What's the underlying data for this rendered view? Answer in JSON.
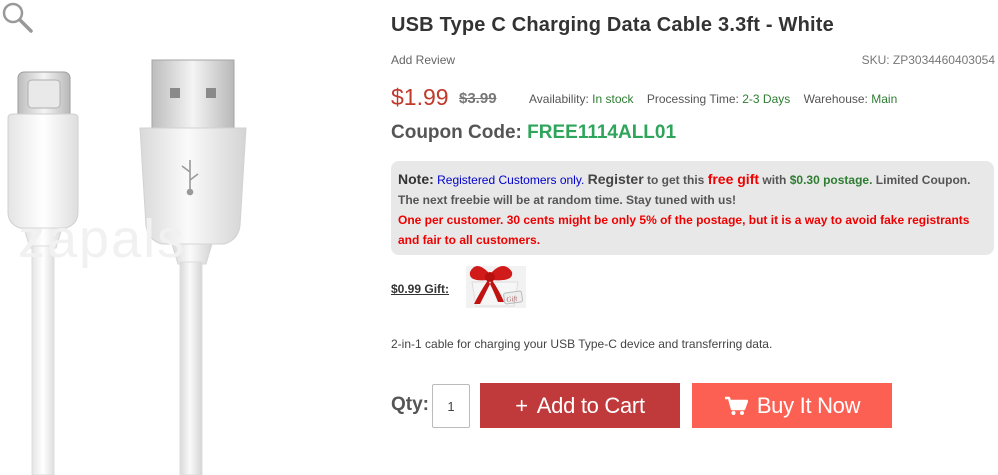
{
  "product": {
    "title": "USB Type C Charging Data Cable 3.3ft - White",
    "add_review": "Add Review",
    "sku": "SKU: ZP3034460403054",
    "price": "$1.99",
    "old_price": "$3.99"
  },
  "meta": {
    "availability_label": "Availability:",
    "availability_value": "In stock",
    "processing_label": "Processing Time:",
    "processing_value": "2-3 Days",
    "warehouse_label": "Warehouse:",
    "warehouse_value": "Main"
  },
  "coupon": {
    "label": "Coupon Code:",
    "code": "FREE1114ALL01"
  },
  "note": {
    "label": "Note:",
    "registered": "Registered Customers only.",
    "register": "Register",
    "get_this": "to get this",
    "free_gift": "free gift",
    "with": "with",
    "postage": "$0.30 postage.",
    "limited": "Limited Coupon. The next freebie will be at random time. Stay tuned with us!",
    "warning": "One per customer. 30 cents might be only 5% of the postage, but it is a way to avoid fake registrants and fair to all customers."
  },
  "gift": {
    "label": "$0.99 Gift:",
    "tag_text": "Gift"
  },
  "description": "2-in-1 cable for charging your USB Type-C device and transferring data.",
  "purchase": {
    "qty_label": "Qty:",
    "qty_value": "1",
    "add_to_cart": "Add to Cart",
    "buy_now": "Buy It Now"
  },
  "image": {
    "watermark": "zapals"
  },
  "icons": {
    "zoom": "magnifier-icon",
    "cart": "cart-icon",
    "plus": "plus-icon",
    "usb": "usb-symbol-icon"
  },
  "colors": {
    "price": "#c0392b",
    "coupon_code": "#2ea55a",
    "add_to_cart_bg": "#c0393b",
    "buy_now_bg": "#fb6053",
    "note_bg": "#e8e8e8",
    "in_stock": "#2e7d32"
  }
}
